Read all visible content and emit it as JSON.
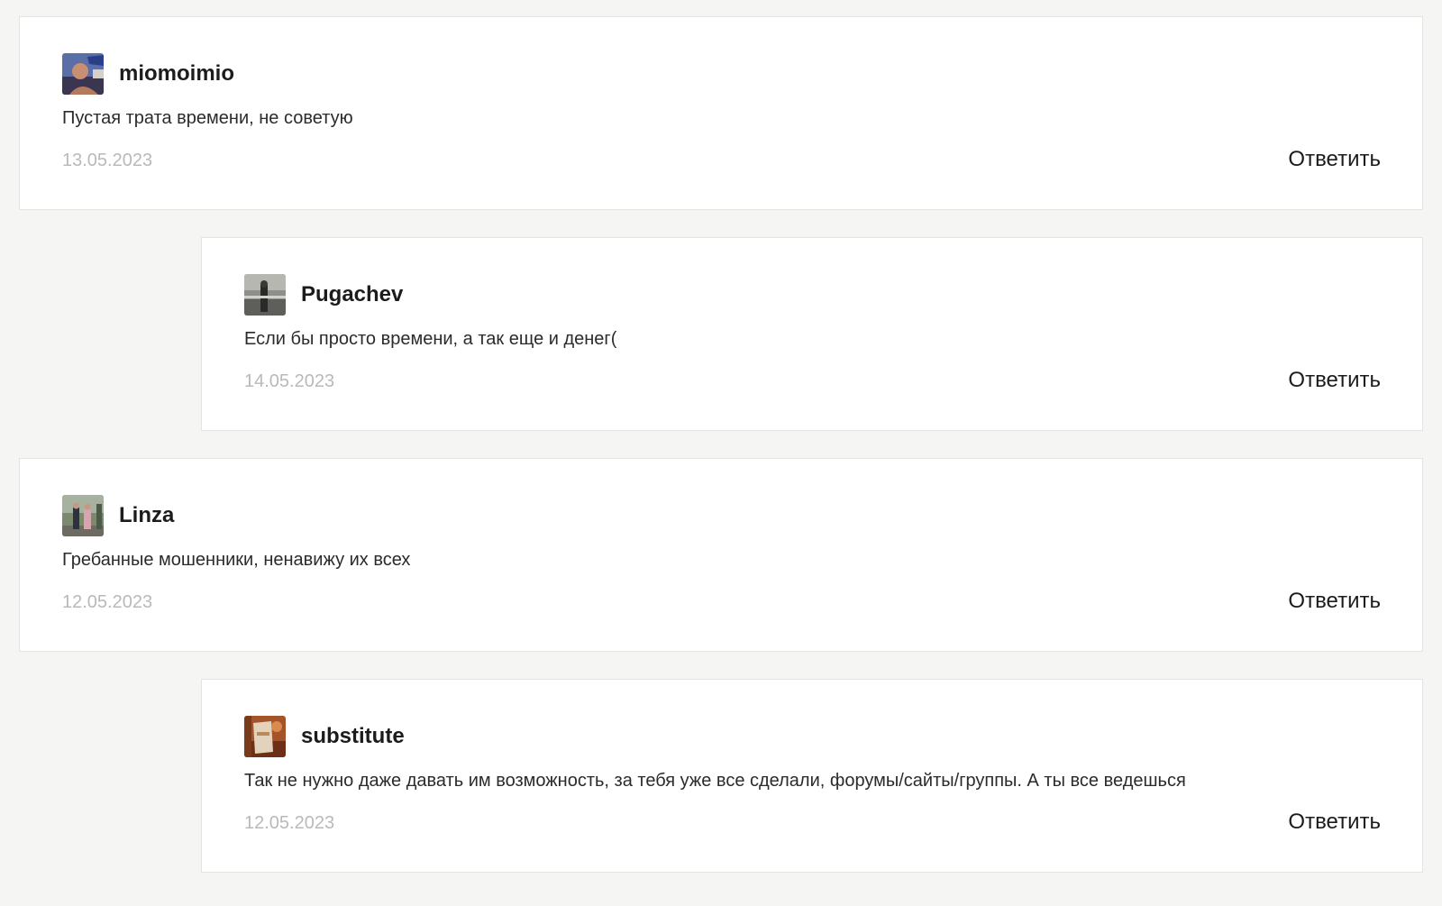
{
  "comments": [
    {
      "author": "miomoimio",
      "avatar_icon": "user-photo-avatar",
      "text": "Пустая трата времени, не советую",
      "date": "13.05.2023",
      "reply_label": "Ответить",
      "is_reply": false
    },
    {
      "author": "Pugachev",
      "avatar_icon": "user-photo-avatar",
      "text": "Если бы просто времени, а так еще и денег(",
      "date": "14.05.2023",
      "reply_label": "Ответить",
      "is_reply": true
    },
    {
      "author": "Linza",
      "avatar_icon": "user-photo-avatar",
      "text": "Гребанные мошенники, ненавижу их всех",
      "date": "12.05.2023",
      "reply_label": "Ответить",
      "is_reply": false
    },
    {
      "author": "substitute",
      "avatar_icon": "user-photo-avatar",
      "text": "Так не нужно даже давать им возможность, за тебя уже все сделали, форумы/сайты/группы. А ты все ведешься",
      "date": "12.05.2023",
      "reply_label": "Ответить",
      "is_reply": true
    }
  ],
  "colors": {
    "page_background": "#f5f5f3",
    "card_background": "#ffffff",
    "card_border": "#e4e4e2",
    "date_text": "#b9b9b9",
    "main_text": "#1c1c1c"
  }
}
